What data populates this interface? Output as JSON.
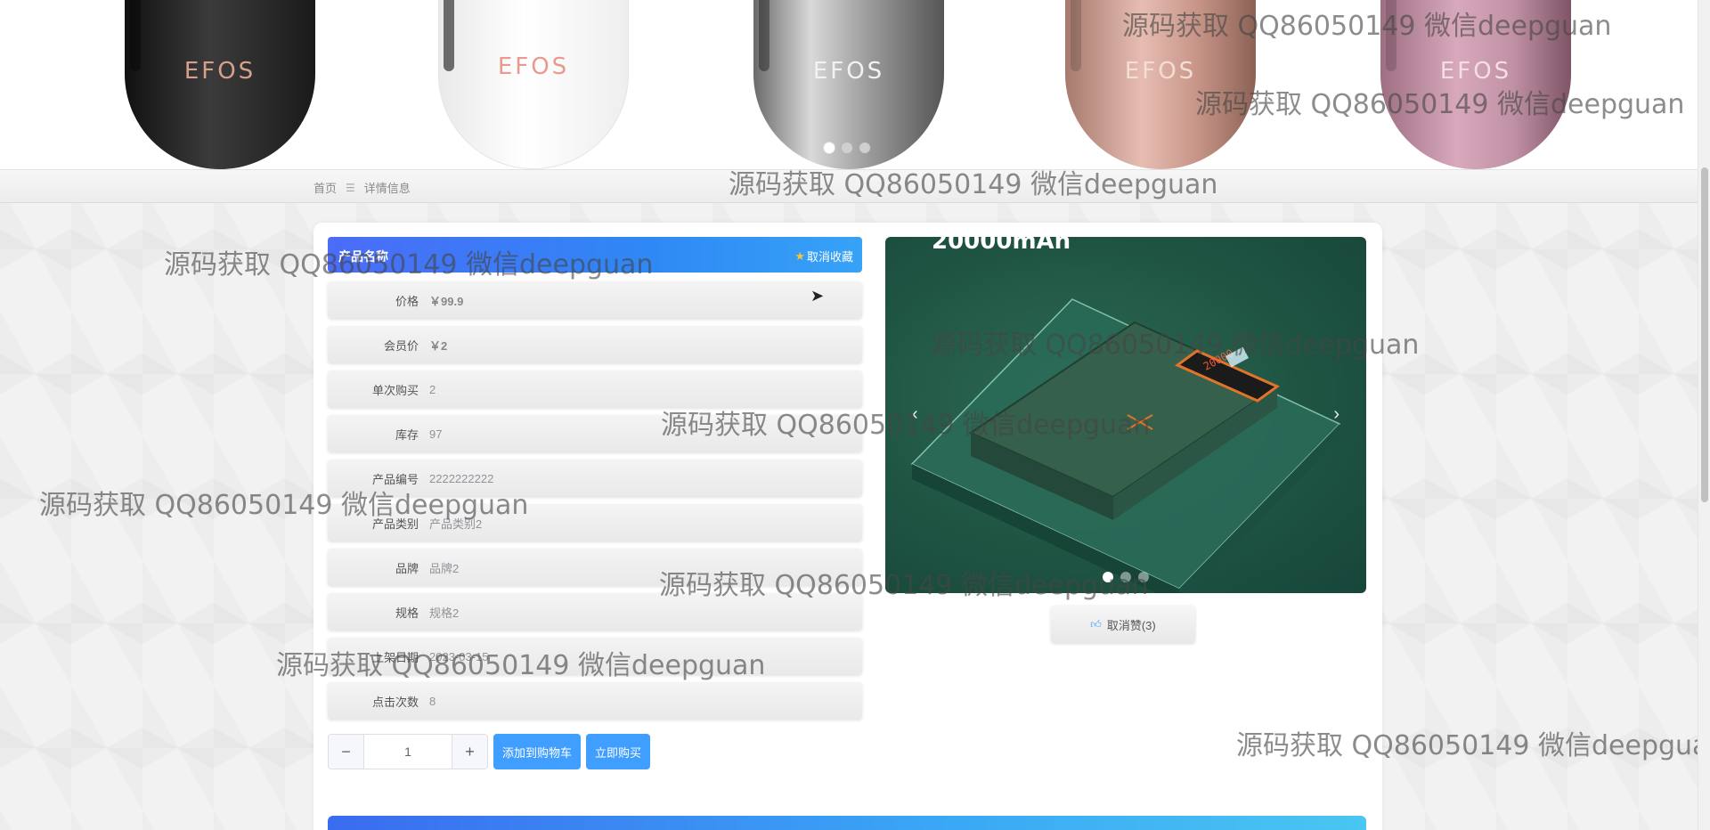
{
  "banner": {
    "brand": "EFOS",
    "dots": 3,
    "active_dot": 1
  },
  "breadcrumb": {
    "home": "首页",
    "separator": "☰",
    "current": "详情信息"
  },
  "product": {
    "title": "产品名称",
    "favorite_label": "取消收藏",
    "favorite_icon": "star-icon",
    "fields": [
      {
        "key": "price",
        "label": "价格",
        "value": "￥99.9"
      },
      {
        "key": "member_price",
        "label": "会员价",
        "value": "￥2"
      },
      {
        "key": "single_purchase",
        "label": "单次购买",
        "value": "2"
      },
      {
        "key": "stock",
        "label": "库存",
        "value": "97"
      },
      {
        "key": "product_code",
        "label": "产品编号",
        "value": "2222222222"
      },
      {
        "key": "category",
        "label": "产品类别",
        "value": "产品类别2"
      },
      {
        "key": "brand",
        "label": "品牌",
        "value": "品牌2"
      },
      {
        "key": "spec",
        "label": "规格",
        "value": "规格2"
      },
      {
        "key": "listed_date",
        "label": "上架日期",
        "value": "2023-03-15"
      },
      {
        "key": "clicks",
        "label": "点击次数",
        "value": "8"
      }
    ],
    "quantity": "1",
    "minus_label": "−",
    "plus_label": "+",
    "add_to_cart_label": "添加到购物车",
    "buy_now_label": "立即购买"
  },
  "gallery": {
    "caption": "20000mAh",
    "prev_icon": "chevron-left-icon",
    "next_icon": "chevron-right-icon",
    "dots": 3,
    "active_dot": 1
  },
  "like": {
    "label": "取消赞(3)",
    "icon": "thumbs-up-icon"
  },
  "watermark": "源码获取 QQ86050149 微信deepguan",
  "colors": {
    "primary": "#409eff",
    "title_gradient_start": "#4a6cf7",
    "title_gradient_end": "#36a3f7",
    "star": "#f7c23c"
  }
}
